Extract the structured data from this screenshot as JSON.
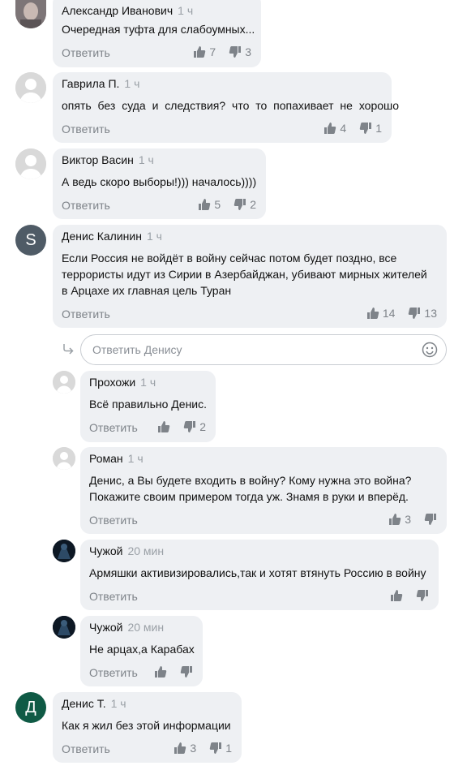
{
  "comments": [
    {
      "author": "Александр Иванович",
      "time": "1 ч",
      "lines": [
        "Очередная туфта для слабоумных..."
      ],
      "reply": "Ответить",
      "likes": "7",
      "dislikes": "3",
      "avatar": "photo"
    },
    {
      "author": "Гаврила П.",
      "time": "1 ч",
      "lines": [
        "опять без суда и следствия? что то попахивает не хорошо"
      ],
      "reply": "Ответить",
      "likes": "4",
      "dislikes": "1",
      "avatar": "default"
    },
    {
      "author": "Виктор Васин",
      "time": "1 ч",
      "lines": [
        "А ведь скоро выборы!))) началось))))"
      ],
      "reply": "Ответить",
      "likes": "5",
      "dislikes": "2",
      "avatar": "default"
    },
    {
      "author": "Денис Калинин",
      "time": "1 ч",
      "lines": [
        "Если Россия не войдёт в войну сейчас потом будет поздно, все",
        "террористы идут из Сирии в Азербайджан, убивают мирных жителей",
        "в Арцахе их главная цель Туран"
      ],
      "reply": "Ответить",
      "likes": "14",
      "dislikes": "13",
      "avatar": "S",
      "avatar_color": "#4f5b66"
    },
    {
      "author": "Прохожи",
      "time": "1 ч",
      "lines": [
        "Всё правильно Денис."
      ],
      "reply": "Ответить",
      "likes": "",
      "dislikes": "2",
      "avatar": "default"
    },
    {
      "author": "Роман",
      "time": "1 ч",
      "lines": [
        "Денис, а Вы будете входить в войну? Кому нужна это война?",
        "Покажите своим примером тогда уж. Знамя в руки и вперёд."
      ],
      "reply": "Ответить",
      "likes": "3",
      "dislikes": "",
      "avatar": "default"
    },
    {
      "author": "Чужой",
      "time": "20 мин",
      "lines": [
        "Армяшки активизировались,так и хотят втянуть Россию в войну"
      ],
      "reply": "Ответить",
      "likes": "",
      "dislikes": "",
      "avatar": "dark"
    },
    {
      "author": "Чужой",
      "time": "20 мин",
      "lines": [
        "Не арцах,а Карабах"
      ],
      "reply": "Ответить",
      "likes": "",
      "dislikes": "",
      "avatar": "dark"
    },
    {
      "author": "Денис Т.",
      "time": "1 ч",
      "lines": [
        "Как я жил без этой информации"
      ],
      "reply": "Ответить",
      "likes": "3",
      "dislikes": "1",
      "avatar": "Д",
      "avatar_color": "#0f5a45"
    }
  ],
  "reply_box": {
    "placeholder": "Ответить Денису"
  },
  "colors": {
    "bubble": "#eef0f3",
    "meta": "#7e8389",
    "time": "#9aa0a6"
  }
}
